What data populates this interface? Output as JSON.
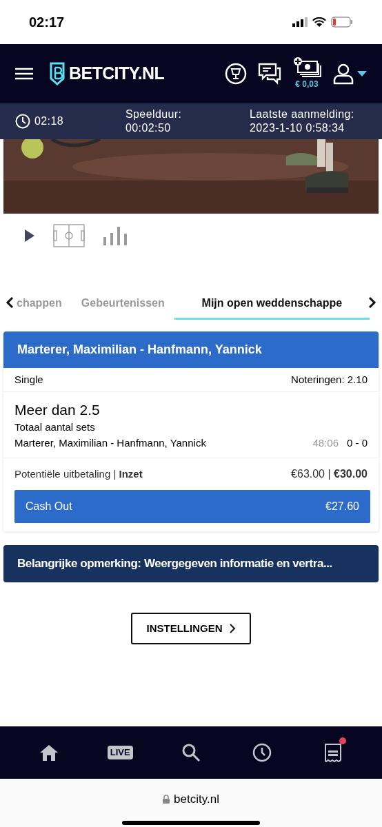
{
  "status_bar": {
    "time": "02:17"
  },
  "header": {
    "logo": "BETCITY.NL",
    "balance": "€ 0,03"
  },
  "info_bar": {
    "clock": "02:18",
    "duration_label": "Speelduur:",
    "duration": "00:02:50",
    "last_login_label": "Laatste aanmelding:",
    "last_login": "2023-1-10 0:58:34"
  },
  "media": {
    "kind": "picture",
    "controls": [
      {
        "kind": "play",
        "selected": true
      },
      {
        "kind": "field",
        "selected": false
      },
      {
        "kind": "stats",
        "selected": false
      }
    ]
  },
  "tabs": [
    {
      "label": "chappen",
      "selected": false
    },
    {
      "label": "Gebeurtenissen",
      "selected": false
    },
    {
      "label": "Mijn open weddenschappe",
      "selected": true
    }
  ],
  "bet": {
    "title": "Marterer, Maximilian - Hanfmann, Yannick",
    "type": "Single",
    "odds": "Noteringen: 2.10",
    "selection": "Meer dan 2.5",
    "market": "Totaal aantal sets",
    "event": "Marterer, Maximilian - Hanfmann, Yannick",
    "time": "48:06",
    "score": "0 - 0",
    "payout_label": "Potentiële uitbetaling | **Inzet**",
    "payout_value": "€63.00 | **€30.00**",
    "cashout_label": "Cash Out",
    "cashout_value": "€27.60"
  },
  "notice": "Belangrijke opmerking: Weergegeven informatie en vertra...",
  "settings_button": "INSTELLINGEN",
  "bottom_nav": [
    {
      "kind": "home",
      "badge": false
    },
    {
      "kind": "live",
      "label": "LIVE",
      "badge": false
    },
    {
      "kind": "search",
      "badge": false
    },
    {
      "kind": "clock",
      "badge": false
    },
    {
      "kind": "receipt",
      "badge": true
    }
  ],
  "url_bar": "betcity.nl"
}
